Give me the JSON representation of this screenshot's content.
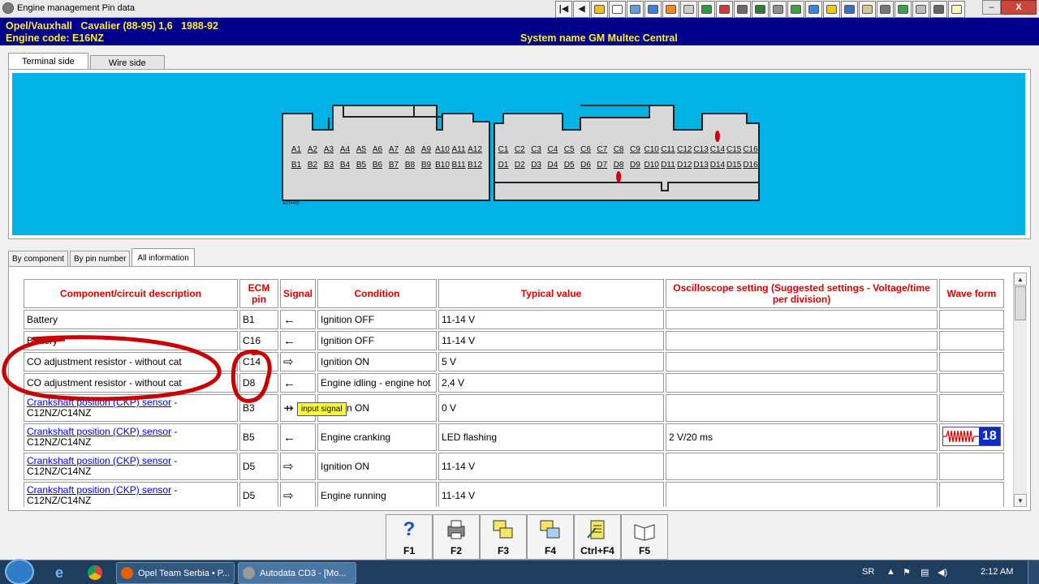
{
  "window": {
    "title": "Engine management Pin data",
    "close_label": "X"
  },
  "toolbar": {
    "first_label": "|◀",
    "prev_label": "◀",
    "icons": [
      "warning-icon",
      "document-icon",
      "graph-icon",
      "tool-icon",
      "gear-icon",
      "gauge-icon",
      "battery-icon",
      "tools-icon",
      "wiring-icon",
      "exit-icon",
      "wrench-icon",
      "pencil-icon",
      "car-icon",
      "plug-icon",
      "meter-icon",
      "sensor-icon",
      "cable-icon",
      "fan-icon",
      "engine-icon",
      "info-icon",
      "clipboard-icon"
    ]
  },
  "header": {
    "vehicle": "Opel/Vauxhall   Cavalier (88-95) 1,6   1988-92",
    "engine_code": "Engine code: E16NZ",
    "system": "System name GM Multec Central"
  },
  "tabs_top": [
    "Terminal side",
    "Wire side"
  ],
  "connector": {
    "left_rows": [
      [
        "A1",
        "A2",
        "A3",
        "A4",
        "A5",
        "A6",
        "A7",
        "A8",
        "A9",
        "A10",
        "A11",
        "A12"
      ],
      [
        "B1",
        "B2",
        "B3",
        "B4",
        "B5",
        "B6",
        "B7",
        "B8",
        "B9",
        "B10",
        "B11",
        "B12"
      ]
    ],
    "right_rows": [
      [
        "C1",
        "C2",
        "C3",
        "C4",
        "C5",
        "C6",
        "C7",
        "C8",
        "C9",
        "C10",
        "C11",
        "C12",
        "C13",
        "C14",
        "C15",
        "C16"
      ],
      [
        "D1",
        "D2",
        "D3",
        "D4",
        "D5",
        "D6",
        "D7",
        "D8",
        "D9",
        "D10",
        "D11",
        "D12",
        "D13",
        "D14",
        "D15",
        "D16"
      ]
    ],
    "ref": "AD74495",
    "highlighted_pins": [
      "C14",
      "D8"
    ],
    "highlight_color": "#d40000"
  },
  "tabs_bottom": [
    "By component",
    "By pin number",
    "All information"
  ],
  "table": {
    "headers": {
      "component": "Component/circuit description",
      "ecm_pin": "ECM pin",
      "signal": "Signal",
      "condition": "Condition",
      "typical": "Typical value",
      "osc": "Oscilloscope setting (Suggested settings - Voltage/time per division)",
      "wave": "Wave form"
    },
    "rows": [
      {
        "component": "Battery",
        "link": "",
        "suffix": "",
        "pin": "B1",
        "signal": "←",
        "condition": "Ignition OFF",
        "typical": "11-14 V",
        "osc": "",
        "wave": ""
      },
      {
        "component": "Battery",
        "link": "",
        "suffix": "",
        "pin": "C16",
        "signal": "←",
        "condition": "Ignition OFF",
        "typical": "11-14 V",
        "osc": "",
        "wave": ""
      },
      {
        "component": "CO adjustment resistor - without cat",
        "link": "",
        "suffix": "",
        "pin": "C14",
        "signal": "⇨",
        "condition": "Ignition ON",
        "typical": "5 V",
        "osc": "",
        "wave": ""
      },
      {
        "component": "CO adjustment resistor - without cat",
        "link": "",
        "suffix": "",
        "pin": "D8",
        "signal": "←",
        "condition": "Engine idling - engine hot",
        "typical": "2,4 V",
        "osc": "",
        "wave": ""
      },
      {
        "component": "",
        "link": "Crankshaft position (CKP) sensor",
        "suffix": " - C12NZ/C14NZ",
        "pin": "B3",
        "signal": "⇸",
        "condition": "Ignition ON",
        "typical": "0 V",
        "osc": "",
        "wave": ""
      },
      {
        "component": "",
        "link": "Crankshaft position (CKP) sensor",
        "suffix": " - C12NZ/C14NZ",
        "pin": "B5",
        "signal": "←",
        "condition": "Engine cranking",
        "typical": "LED flashing",
        "osc": "2 V/20 ms",
        "wave": "18"
      },
      {
        "component": "",
        "link": "Crankshaft position (CKP) sensor",
        "suffix": " - C12NZ/C14NZ",
        "pin": "D5",
        "signal": "⇨",
        "condition": "Ignition ON",
        "typical": "11-14 V",
        "osc": "",
        "wave": ""
      },
      {
        "component": "",
        "link": "Crankshaft position (CKP) sensor",
        "suffix": " - C12NZ/C14NZ",
        "pin": "D5",
        "signal": "⇨",
        "condition": "Engine running",
        "typical": "11-14 V",
        "osc": "",
        "wave": ""
      }
    ]
  },
  "tooltip": "input signal",
  "annotation_color": "#c80000",
  "fkeys": [
    {
      "label": "F1",
      "icon": "help-icon"
    },
    {
      "label": "F2",
      "icon": "print-icon"
    },
    {
      "label": "F3",
      "icon": "copy-icon"
    },
    {
      "label": "F4",
      "icon": "export-icon"
    },
    {
      "label": "Ctrl+F4",
      "icon": "edit-document-icon"
    },
    {
      "label": "F5",
      "icon": "book-icon"
    }
  ],
  "taskbar": {
    "tasks": [
      {
        "label": "Opel Team Serbia • P...",
        "icon": "firefox-icon"
      },
      {
        "label": "Autodata CD3 - [Mo...",
        "icon": "autodata-icon"
      }
    ],
    "language": "SR",
    "time": "2:12 AM"
  }
}
